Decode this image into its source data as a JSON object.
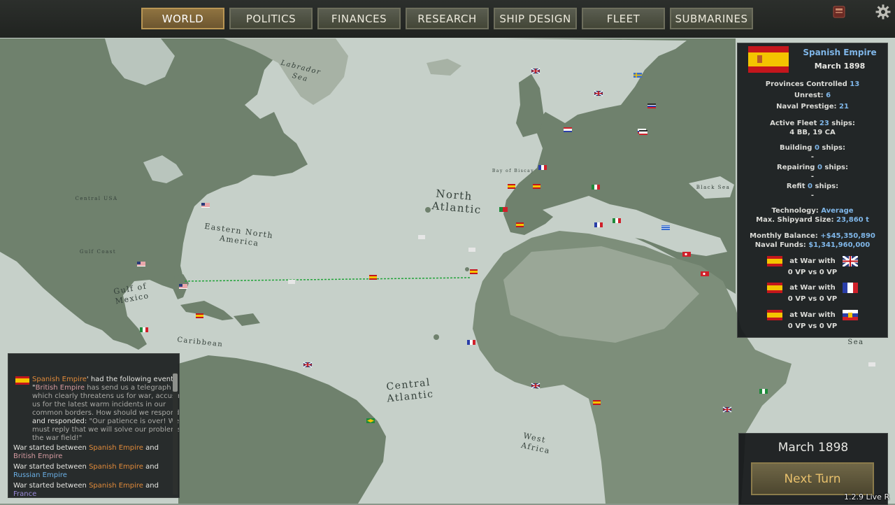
{
  "tabs": [
    "WORLD",
    "POLITICS",
    "FINANCES",
    "RESEARCH",
    "SHIP DESIGN",
    "FLEET",
    "SUBMARINES"
  ],
  "active_tab": "WORLD",
  "icons": {
    "top_right": [
      "scrapbook-icon",
      "settings-gear-icon"
    ]
  },
  "map_labels": {
    "labrador_sea": [
      "Labrador",
      "Sea"
    ],
    "north_atlantic": [
      "North",
      "Atlantic"
    ],
    "eastern_north_america": [
      "Eastern North",
      "America"
    ],
    "gulf_of_mexico": [
      "Gulf of",
      "Mexico"
    ],
    "caribbean": "Caribbean",
    "central_atlantic": [
      "Central",
      "Atlantic"
    ],
    "west_africa": [
      "West",
      "Africa"
    ],
    "sea": "Sea",
    "black_sea": "Black Sea",
    "central_usa": "Central USA",
    "gulf_coast": "Gulf Coast",
    "bay_of_biscay": "Bay of Biscay"
  },
  "nation_panel": {
    "flag": "spain-flag",
    "nation": "Spanish Empire",
    "date": "March 1898",
    "provinces_label": "Provinces Controlled",
    "provinces": "13",
    "unrest_label": "Unrest:",
    "unrest": "6",
    "prestige_label": "Naval Prestige:",
    "prestige": "21",
    "fleet_label": "Active Fleet",
    "fleet": "23",
    "ships_word": "ships:",
    "fleet_detail": "4 BB, 19 CA",
    "building_label": "Building",
    "building": "0",
    "repairing_label": "Repairing",
    "repairing": "0",
    "refit_label": "Refit",
    "refit": "0",
    "dash": "-",
    "tech_label": "Technology:",
    "tech": "Average",
    "shipyard_label": "Max. Shipyard Size:",
    "shipyard": "23,860 t",
    "balance_label": "Monthly Balance:",
    "balance": "+$45,350,890",
    "funds_label": "Naval Funds:",
    "funds": "$1,341,960,000",
    "wars": [
      {
        "text": "at War with",
        "enemy_flag": "british-flag",
        "vp": "0 VP vs 0 VP"
      },
      {
        "text": "at War with",
        "enemy_flag": "french-flag",
        "vp": "0 VP vs 0 VP"
      },
      {
        "text": "at War with",
        "enemy_flag": "russian-flag",
        "vp": "0 VP vs 0 VP"
      }
    ]
  },
  "event_log": {
    "event": {
      "nation": "Spanish Empire",
      "intro": "' had the following event:",
      "quote_open": "\"",
      "sender": "British Empire",
      "body": [
        " has send us a telegraph",
        "which clearly threatens us for war, accusing",
        "us for the latest warm incidents in our",
        "common borders. How should we respond?\""
      ],
      "responded": "and responded: ",
      "reply": [
        "\"Our patience is over! We",
        "must reply that we will solve our problems in",
        "the war field!\""
      ]
    },
    "wars": [
      {
        "prefix": "War started between ",
        "a": "Spanish Empire",
        "and": " and",
        "b": "British Empire"
      },
      {
        "prefix": "War started between ",
        "a": "Spanish Empire",
        "and": " and",
        "b": "Russian Empire"
      },
      {
        "prefix": "War started between ",
        "a": "Spanish Empire",
        "and": " and",
        "b": "France"
      }
    ]
  },
  "turn": {
    "date": "March 1898",
    "button": "Next Turn"
  },
  "version": "1.2.9 Live R",
  "colors": {
    "ocean": "#c6d0c9",
    "land": "#6f816d",
    "land_light": "#a7b2a5",
    "accent_gold": "#e8c06c",
    "highlight_blue": "#7fb6e8",
    "route": "#22a33a"
  }
}
